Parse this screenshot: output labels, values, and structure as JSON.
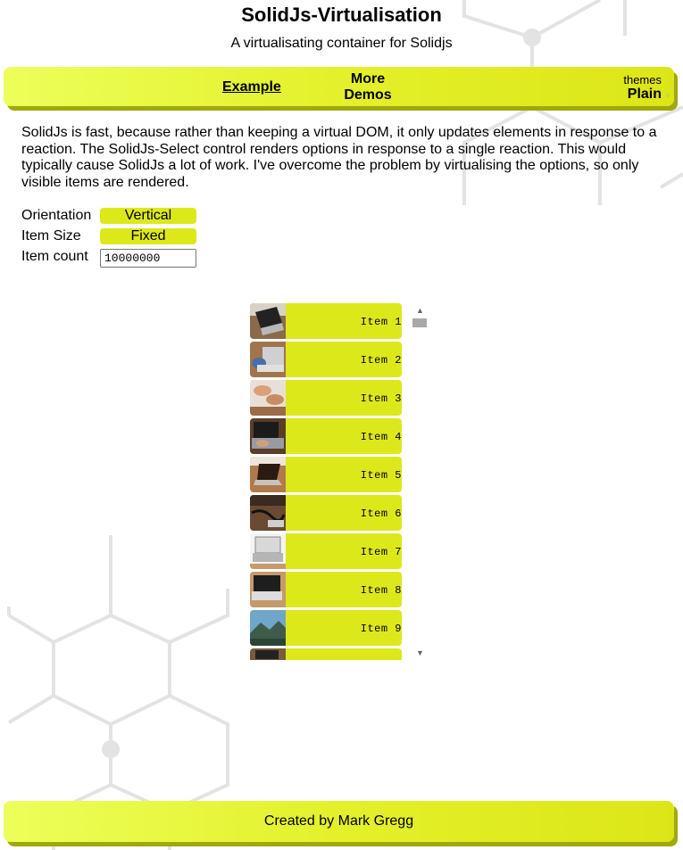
{
  "header": {
    "title": "SolidJs-Virtualisation",
    "subtitle": "A virtualisating container for Solidjs"
  },
  "nav": {
    "example_label": "Example",
    "more_demos_line1": "More",
    "more_demos_line2": "Demos",
    "themes_label": "themes",
    "themes_value": "Plain"
  },
  "intro": "SolidJs is fast, because rather than keeping a virtual DOM, it only updates elements in response to a reaction. The SolidJs-Select control renders options in response to a single reaction. This would typically cause SolidJs a lot of work. I've overcome the problem by virtualising the options, so only visible items are rendered.",
  "controls": {
    "orientation_label": "Orientation",
    "orientation_value": "Vertical",
    "item_size_label": "Item Size",
    "item_size_value": "Fixed",
    "item_count_label": "Item count",
    "item_count_value": "10000000"
  },
  "list": {
    "items": [
      {
        "label": "Item 1",
        "thumb": "laptop-desk-photo"
      },
      {
        "label": "Item 2",
        "thumb": "hands-laptop-photo"
      },
      {
        "label": "Item 3",
        "thumb": "hands-keyboard-photo"
      },
      {
        "label": "Item 4",
        "thumb": "typing-laptop-photo"
      },
      {
        "label": "Item 5",
        "thumb": "laptop-table-photo"
      },
      {
        "label": "Item 6",
        "thumb": "desk-cables-photo"
      },
      {
        "label": "Item 7",
        "thumb": "open-laptop-photo"
      },
      {
        "label": "Item 8",
        "thumb": "laptop-wood-photo"
      },
      {
        "label": "Item 9",
        "thumb": "mountain-landscape-photo"
      },
      {
        "label": "",
        "thumb": "partial-photo"
      }
    ]
  },
  "footer": {
    "credit": "Created by Mark Gregg"
  },
  "colors": {
    "accent": "#dde81a",
    "bar_gradient_start": "#ecff5a",
    "bar_gradient_end": "#dce617",
    "bar_shadow": "#9fa80c",
    "hex_lines": "#e3e3e3",
    "scroll_thumb": "#a9a9a9"
  }
}
